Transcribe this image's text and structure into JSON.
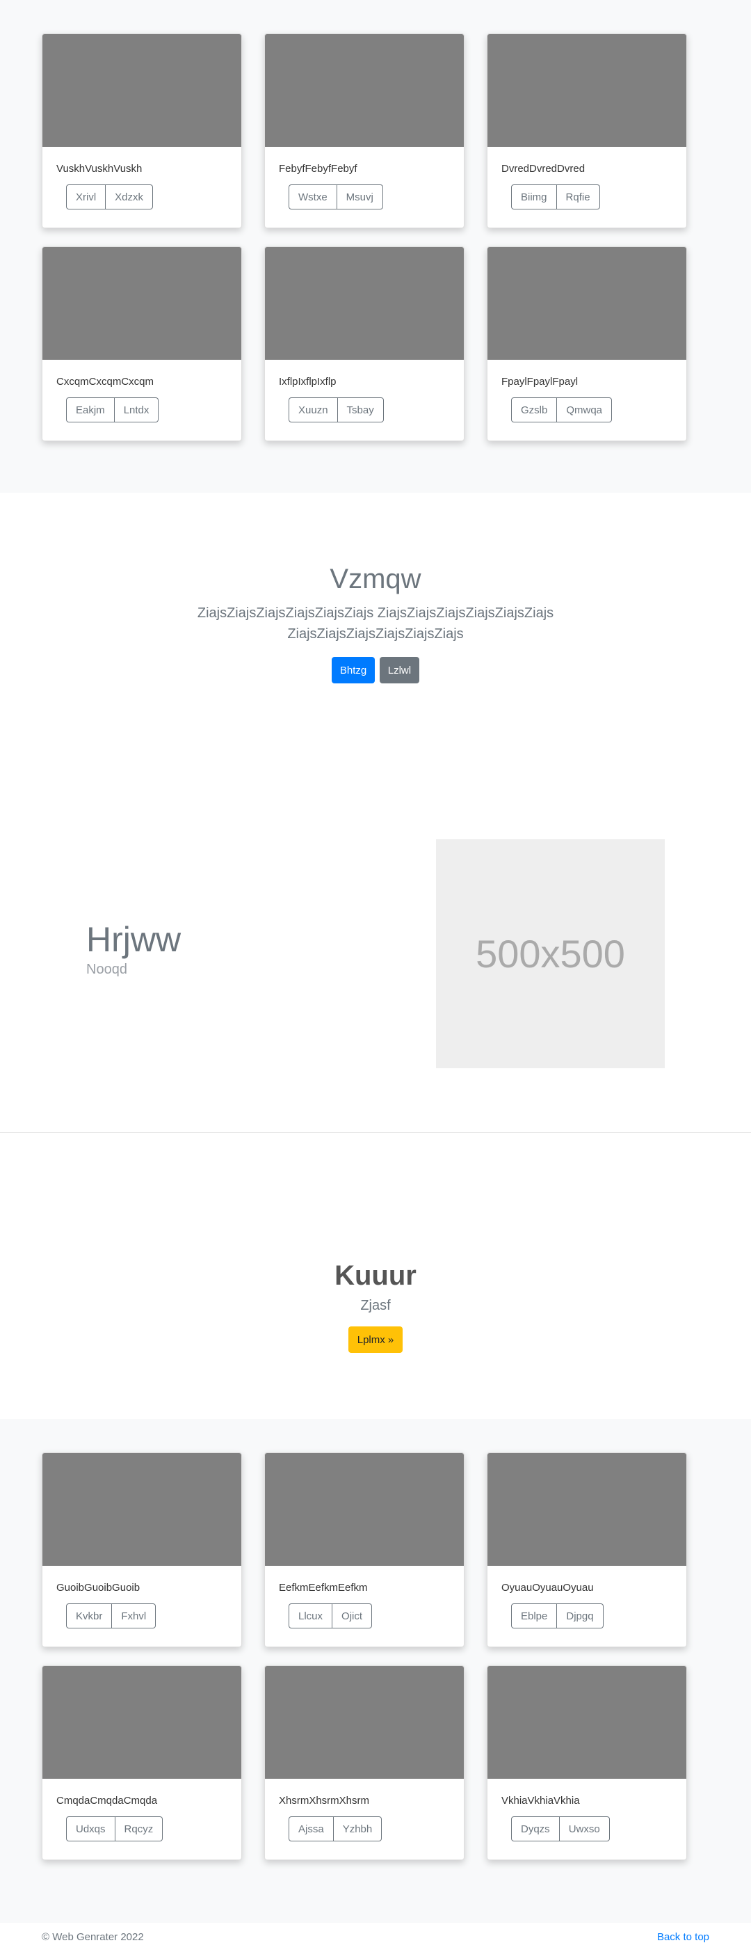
{
  "album_top": {
    "cards": [
      {
        "text": "VuskhVuskhVuskh",
        "buttons": [
          "Xrivl",
          "Xdzxk"
        ]
      },
      {
        "text": "FebyfFebyfFebyf",
        "buttons": [
          "Wstxe",
          "Msuvj"
        ]
      },
      {
        "text": "DvredDvredDvred",
        "buttons": [
          "Biimg",
          "Rqfie"
        ]
      },
      {
        "text": "CxcqmCxcqmCxcqm",
        "buttons": [
          "Eakjm",
          "Lntdx"
        ]
      },
      {
        "text": "IxflpIxflpIxflp",
        "buttons": [
          "Xuuzn",
          "Tsbay"
        ]
      },
      {
        "text": "FpaylFpaylFpayl",
        "buttons": [
          "Gzslb",
          "Qmwqa"
        ]
      }
    ]
  },
  "jumbotron": {
    "heading": "Vzmqw",
    "lead": "ZiajsZiajsZiajsZiajsZiajsZiajs ZiajsZiajsZiajsZiajsZiajsZiajs ZiajsZiajsZiajsZiajsZiajsZiajs",
    "primary_button": "Bhtzg",
    "secondary_button": "Lzlwl"
  },
  "feature": {
    "heading": "Hrjww",
    "subheading": "Nooqd",
    "image_label": "500x500"
  },
  "cta": {
    "heading": "Kuuur",
    "subheading": "Zjasf",
    "button": "Lplmx »"
  },
  "album_bottom": {
    "cards": [
      {
        "text": "GuoibGuoibGuoib",
        "buttons": [
          "Kvkbr",
          "Fxhvl"
        ]
      },
      {
        "text": "EefkmEefkmEefkm",
        "buttons": [
          "Llcux",
          "Ojict"
        ]
      },
      {
        "text": "OyuauOyuauOyuau",
        "buttons": [
          "Eblpe",
          "Djpgq"
        ]
      },
      {
        "text": "CmqdaCmqdaCmqda",
        "buttons": [
          "Udxqs",
          "Rqcyz"
        ]
      },
      {
        "text": "XhsrmXhsrmXhsrm",
        "buttons": [
          "Ajssa",
          "Yzhbh"
        ]
      },
      {
        "text": "VkhiaVkhiaVkhia",
        "buttons": [
          "Dyqzs",
          "Uwxso"
        ]
      }
    ]
  },
  "footer": {
    "copyright": "© Web Genrater 2022",
    "back_to_top": "Back to top"
  },
  "colors": {
    "primary": "#007bff",
    "secondary": "#6c757d",
    "warning": "#ffc107",
    "card_image": "#808080",
    "band_background": "#f8f9fa"
  }
}
